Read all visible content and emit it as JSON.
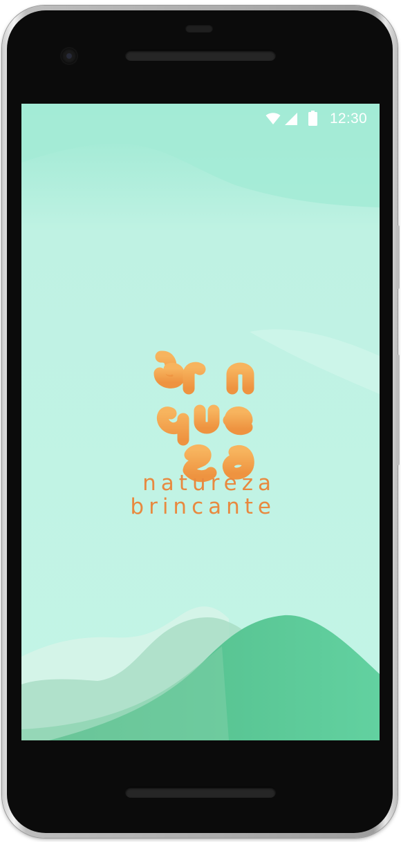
{
  "status_bar": {
    "time": "12:30",
    "icons": [
      "wifi-icon",
      "signal-icon",
      "battery-icon"
    ]
  },
  "logo": {
    "name": "brinqueza logo",
    "wordmark_lines": [
      "brin",
      "que",
      "za"
    ],
    "tagline_line1": "natureza",
    "tagline_line2": "brincante"
  },
  "colors": {
    "background_top": "#9ae8d1",
    "background": "#c3f4e6",
    "hill_green": "#58c48e",
    "logo_orange": "#f0a04a",
    "tagline_orange": "#e8893f"
  }
}
